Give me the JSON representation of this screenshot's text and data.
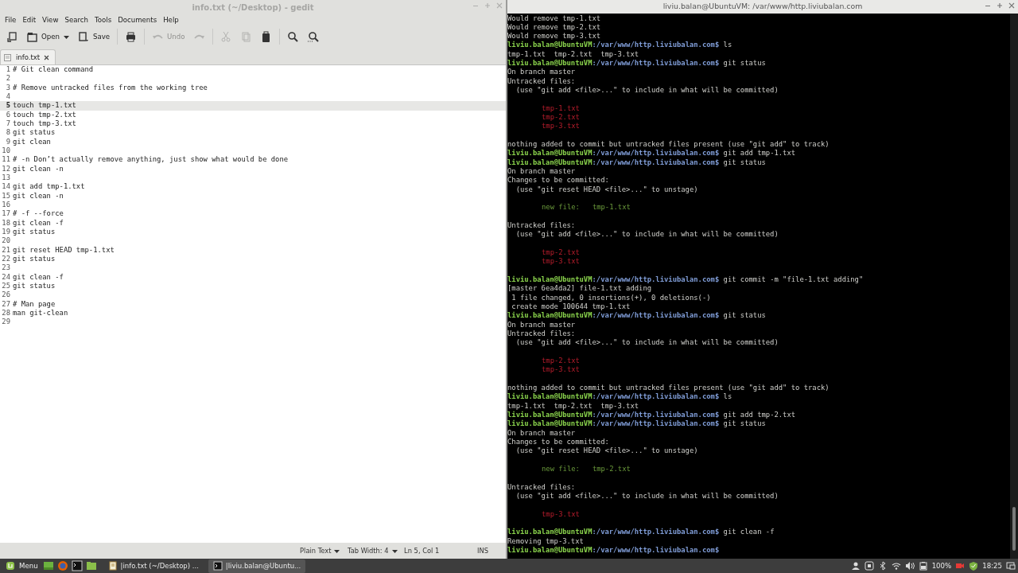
{
  "editor_window": {
    "title": "info.txt (~/Desktop) - gedit",
    "menu": [
      "File",
      "Edit",
      "View",
      "Search",
      "Tools",
      "Documents",
      "Help"
    ],
    "toolbar": [
      {
        "kind": "new",
        "disabled": false
      },
      {
        "kind": "open",
        "label": "Open",
        "disabled": false
      },
      {
        "kind": "save",
        "label": "Save",
        "disabled": false
      },
      {
        "kind": "print",
        "disabled": false
      },
      {
        "kind": "undo",
        "label": "Undo",
        "disabled": true
      },
      {
        "kind": "redo",
        "disabled": true
      },
      {
        "kind": "cut",
        "disabled": true
      },
      {
        "kind": "copy",
        "disabled": true
      },
      {
        "kind": "paste",
        "disabled": false
      },
      {
        "kind": "find",
        "disabled": false
      },
      {
        "kind": "replace",
        "disabled": false
      }
    ],
    "tabs": [
      {
        "label": "info.txt",
        "selected": true
      }
    ],
    "lines": [
      {
        "number": "1",
        "text": "# Git clean command",
        "current": false
      },
      {
        "number": "2",
        "current": false
      },
      {
        "number": "3",
        "text": "# Remove untracked files from the working tree",
        "current": false
      },
      {
        "number": "4",
        "current": false
      },
      {
        "number": "5",
        "text": "touch tmp-1.txt",
        "current": true
      },
      {
        "number": "6",
        "text": "touch tmp-2.txt",
        "current": false
      },
      {
        "number": "7",
        "text": "touch tmp-3.txt",
        "current": false
      },
      {
        "number": "8",
        "text": "git status",
        "current": false
      },
      {
        "number": "9",
        "text": "git clean",
        "current": false
      },
      {
        "number": "10",
        "current": false
      },
      {
        "number": "11",
        "text": "# -n Don’t actually remove anything, just show what would be done",
        "current": false
      },
      {
        "number": "12",
        "text": "git clean -n",
        "current": false
      },
      {
        "number": "13",
        "current": false
      },
      {
        "number": "14",
        "text": "git add tmp-1.txt",
        "current": false
      },
      {
        "number": "15",
        "text": "git clean -n",
        "current": false
      },
      {
        "number": "16",
        "current": false
      },
      {
        "number": "17",
        "text": "# -f --force",
        "current": false
      },
      {
        "number": "18",
        "text": "git clean -f",
        "current": false
      },
      {
        "number": "19",
        "text": "git status",
        "current": false
      },
      {
        "number": "20",
        "current": false
      },
      {
        "number": "21",
        "text": "git reset HEAD tmp-1.txt",
        "current": false
      },
      {
        "number": "22",
        "text": "git status",
        "current": false
      },
      {
        "number": "23",
        "current": false
      },
      {
        "number": "24",
        "text": "git clean -f",
        "current": false
      },
      {
        "number": "25",
        "text": "git status",
        "current": false
      },
      {
        "number": "26",
        "current": false
      },
      {
        "number": "27",
        "text": "# Man page",
        "current": false
      },
      {
        "number": "28",
        "text": "man git-clean",
        "current": false
      },
      {
        "number": "29",
        "current": false
      }
    ],
    "status_bar": {
      "language": "Plain Text",
      "tab_width": "Tab Width: 4",
      "position": "Ln 5, Col 1",
      "mode": "INS"
    }
  },
  "terminal_window": {
    "title": "liviu.balan@UbuntuVM: /var/www/http.liviubalan.com",
    "lines": [
      {
        "kind": "output",
        "text": "Would remove tmp-1.txt"
      },
      {
        "kind": "output",
        "text": "Would remove tmp-2.txt"
      },
      {
        "kind": "output",
        "text": "Would remove tmp-3.txt"
      },
      {
        "kind": "prompt",
        "user": "liviu.balan@UbuntuVM",
        "path": ":/var/www/http.liviubalan.com$",
        "command": " ls"
      },
      {
        "kind": "output",
        "text": "tmp-1.txt  tmp-2.txt  tmp-3.txt"
      },
      {
        "kind": "prompt",
        "user": "liviu.balan@UbuntuVM",
        "path": ":/var/www/http.liviubalan.com$",
        "command": " git status"
      },
      {
        "kind": "output",
        "text": "On branch master"
      },
      {
        "kind": "output",
        "text": "Untracked files:"
      },
      {
        "kind": "output",
        "text": "  (use \"git add <file>...\" to include in what will be committed)"
      },
      {
        "kind": "blank"
      },
      {
        "kind": "untracked",
        "text": "tmp-1.txt"
      },
      {
        "kind": "untracked",
        "text": "tmp-2.txt"
      },
      {
        "kind": "untracked",
        "text": "tmp-3.txt"
      },
      {
        "kind": "blank"
      },
      {
        "kind": "output",
        "text": "nothing added to commit but untracked files present (use \"git add\" to track)"
      },
      {
        "kind": "prompt",
        "user": "liviu.balan@UbuntuVM",
        "path": ":/var/www/http.liviubalan.com$",
        "command": " git add tmp-1.txt"
      },
      {
        "kind": "prompt",
        "user": "liviu.balan@UbuntuVM",
        "path": ":/var/www/http.liviubalan.com$",
        "command": " git status"
      },
      {
        "kind": "output",
        "text": "On branch master"
      },
      {
        "kind": "output",
        "text": "Changes to be committed:"
      },
      {
        "kind": "output",
        "text": "  (use \"git reset HEAD <file>...\" to unstage)"
      },
      {
        "kind": "blank"
      },
      {
        "kind": "staged",
        "text": "new file:   tmp-1.txt"
      },
      {
        "kind": "blank"
      },
      {
        "kind": "output",
        "text": "Untracked files:"
      },
      {
        "kind": "output",
        "text": "  (use \"git add <file>...\" to include in what will be committed)"
      },
      {
        "kind": "blank"
      },
      {
        "kind": "untracked",
        "text": "tmp-2.txt"
      },
      {
        "kind": "untracked",
        "text": "tmp-3.txt"
      },
      {
        "kind": "blank"
      },
      {
        "kind": "prompt",
        "user": "liviu.balan@UbuntuVM",
        "path": ":/var/www/http.liviubalan.com$",
        "command": " git commit -m \"file-1.txt adding\""
      },
      {
        "kind": "output",
        "text": "[master 6ea4da2] file-1.txt adding"
      },
      {
        "kind": "output",
        "text": " 1 file changed, 0 insertions(+), 0 deletions(-)"
      },
      {
        "kind": "output",
        "text": " create mode 100644 tmp-1.txt"
      },
      {
        "kind": "prompt",
        "user": "liviu.balan@UbuntuVM",
        "path": ":/var/www/http.liviubalan.com$",
        "command": " git status"
      },
      {
        "kind": "output",
        "text": "On branch master"
      },
      {
        "kind": "output",
        "text": "Untracked files:"
      },
      {
        "kind": "output",
        "text": "  (use \"git add <file>...\" to include in what will be committed)"
      },
      {
        "kind": "blank"
      },
      {
        "kind": "untracked",
        "text": "tmp-2.txt"
      },
      {
        "kind": "untracked",
        "text": "tmp-3.txt"
      },
      {
        "kind": "blank"
      },
      {
        "kind": "output",
        "text": "nothing added to commit but untracked files present (use \"git add\" to track)"
      },
      {
        "kind": "prompt",
        "user": "liviu.balan@UbuntuVM",
        "path": ":/var/www/http.liviubalan.com$",
        "command": " ls"
      },
      {
        "kind": "output",
        "text": "tmp-1.txt  tmp-2.txt  tmp-3.txt"
      },
      {
        "kind": "prompt",
        "user": "liviu.balan@UbuntuVM",
        "path": ":/var/www/http.liviubalan.com$",
        "command": " git add tmp-2.txt"
      },
      {
        "kind": "prompt",
        "user": "liviu.balan@UbuntuVM",
        "path": ":/var/www/http.liviubalan.com$",
        "command": " git status"
      },
      {
        "kind": "output",
        "text": "On branch master"
      },
      {
        "kind": "output",
        "text": "Changes to be committed:"
      },
      {
        "kind": "output",
        "text": "  (use \"git reset HEAD <file>...\" to unstage)"
      },
      {
        "kind": "blank"
      },
      {
        "kind": "staged",
        "text": "new file:   tmp-2.txt"
      },
      {
        "kind": "blank"
      },
      {
        "kind": "output",
        "text": "Untracked files:"
      },
      {
        "kind": "output",
        "text": "  (use \"git add <file>...\" to include in what will be committed)"
      },
      {
        "kind": "blank"
      },
      {
        "kind": "untracked",
        "text": "tmp-3.txt"
      },
      {
        "kind": "blank"
      },
      {
        "kind": "prompt",
        "user": "liviu.balan@UbuntuVM",
        "path": ":/var/www/http.liviubalan.com$",
        "command": " git clean -f"
      },
      {
        "kind": "output",
        "text": "Removing tmp-3.txt"
      },
      {
        "kind": "prompt",
        "user": "liviu.balan@UbuntuVM",
        "path": ":/var/www/http.liviubalan.com$"
      }
    ]
  },
  "taskbar": {
    "menu_label": "Menu",
    "launchers": [
      {
        "kind": "desktop"
      },
      {
        "kind": "browser"
      },
      {
        "kind": "terminal"
      },
      {
        "kind": "files"
      }
    ],
    "windows": [
      {
        "kind": "editor",
        "label": "|info.txt (~/Desktop) ...",
        "selected": false
      },
      {
        "kind": "terminal",
        "label": "|liviu.balan@Ubuntu...",
        "selected": true
      }
    ],
    "tray": [
      {
        "kind": "user"
      },
      {
        "kind": "chat"
      },
      {
        "kind": "bluetooth"
      },
      {
        "kind": "wifi"
      },
      {
        "kind": "volume"
      },
      {
        "kind": "battery"
      }
    ],
    "battery_text": "100%",
    "tray_after": [
      {
        "kind": "record"
      },
      {
        "kind": "shield"
      }
    ],
    "clock": "18:25"
  }
}
